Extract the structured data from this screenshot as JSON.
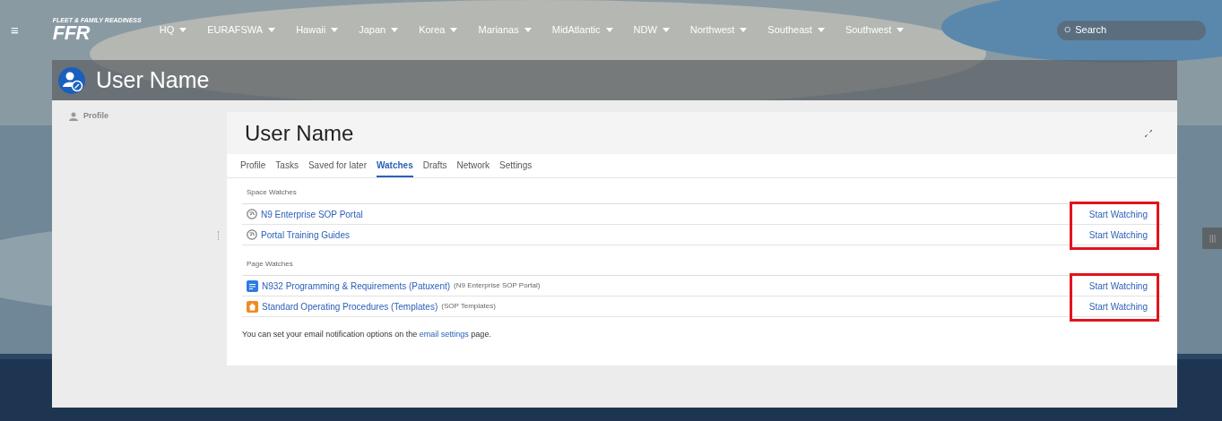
{
  "nav": {
    "menu_icon": "≡",
    "logo": {
      "tagline": "FLEET & FAMILY READINESS",
      "mark": "FFR"
    },
    "items": [
      {
        "label": "HQ"
      },
      {
        "label": "EURAFSWA"
      },
      {
        "label": "Hawaii"
      },
      {
        "label": "Japan"
      },
      {
        "label": "Korea"
      },
      {
        "label": "Marianas"
      },
      {
        "label": "MidAtlantic"
      },
      {
        "label": "NDW"
      },
      {
        "label": "Northwest"
      },
      {
        "label": "Southeast"
      },
      {
        "label": "Southwest"
      }
    ],
    "search": {
      "placeholder": "Search"
    }
  },
  "header": {
    "title": "User Name"
  },
  "sidebar": {
    "items": [
      {
        "label": "Profile"
      }
    ]
  },
  "card": {
    "title": "User Name",
    "tabs": [
      {
        "label": "Profile",
        "selected": false
      },
      {
        "label": "Tasks",
        "selected": false
      },
      {
        "label": "Saved for later",
        "selected": false
      },
      {
        "label": "Watches",
        "selected": true
      },
      {
        "label": "Drafts",
        "selected": false
      },
      {
        "label": "Network",
        "selected": false
      },
      {
        "label": "Settings",
        "selected": false
      }
    ],
    "sections": [
      {
        "heading": "Space Watches",
        "highlighted": true,
        "rows": [
          {
            "kind": "space",
            "title": "N9 Enterprise SOP Portal",
            "action": "Start Watching"
          },
          {
            "kind": "space",
            "title": "Portal Training Guides",
            "action": "Start Watching"
          }
        ]
      },
      {
        "heading": "Page Watches",
        "highlighted": true,
        "rows": [
          {
            "kind": "page",
            "title": "N932 Programming & Requirements (Patuxent)",
            "space": "(N9 Enterprise SOP Portal)",
            "action": "Start Watching"
          },
          {
            "kind": "home",
            "title": "Standard Operating Procedures (Templates)",
            "space": "(SOP Templates)",
            "action": "Start Watching"
          }
        ]
      }
    ],
    "footer": {
      "before": "You can set your email notification options on the",
      "link": "email settings",
      "after": "page."
    }
  }
}
